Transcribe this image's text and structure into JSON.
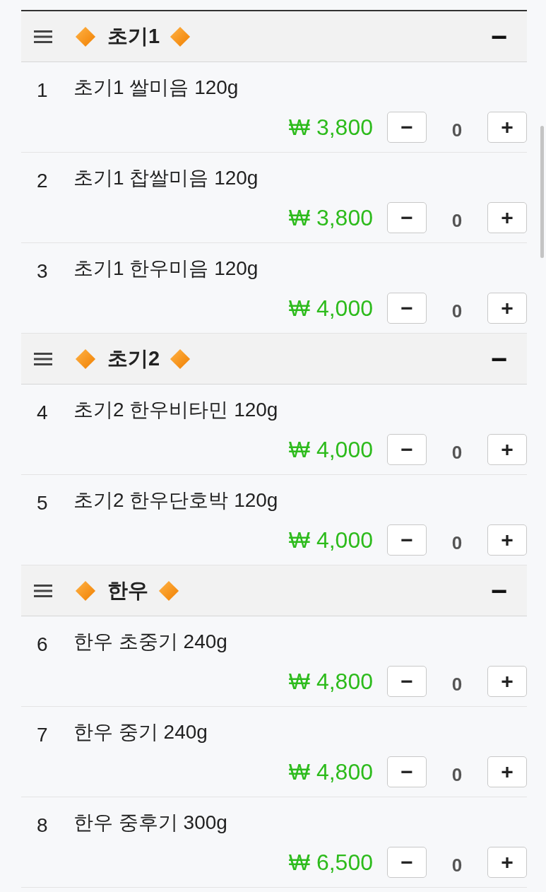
{
  "sections": [
    {
      "title": "초기1",
      "toggle": "−",
      "items": [
        {
          "number": "1",
          "name": "초기1 쌀미음 120g",
          "price": "₩ 3,800",
          "minus": "−",
          "quantity": "0",
          "plus": "+"
        },
        {
          "number": "2",
          "name": "초기1 찹쌀미음 120g",
          "price": "₩ 3,800",
          "minus": "−",
          "quantity": "0",
          "plus": "+"
        },
        {
          "number": "3",
          "name": "초기1 한우미음 120g",
          "price": "₩ 4,000",
          "minus": "−",
          "quantity": "0",
          "plus": "+"
        }
      ]
    },
    {
      "title": "초기2",
      "toggle": "−",
      "items": [
        {
          "number": "4",
          "name": "초기2 한우비타민 120g",
          "price": "₩ 4,000",
          "minus": "−",
          "quantity": "0",
          "plus": "+"
        },
        {
          "number": "5",
          "name": "초기2 한우단호박 120g",
          "price": "₩ 4,000",
          "minus": "−",
          "quantity": "0",
          "plus": "+"
        }
      ]
    },
    {
      "title": "한우",
      "toggle": "−",
      "items": [
        {
          "number": "6",
          "name": "한우 초중기 240g",
          "price": "₩ 4,800",
          "minus": "−",
          "quantity": "0",
          "plus": "+"
        },
        {
          "number": "7",
          "name": "한우 중기 240g",
          "price": "₩ 4,800",
          "minus": "−",
          "quantity": "0",
          "plus": "+"
        },
        {
          "number": "8",
          "name": "한우 중후기 300g",
          "price": "₩ 6,500",
          "minus": "−",
          "quantity": "0",
          "plus": "+"
        }
      ]
    }
  ]
}
